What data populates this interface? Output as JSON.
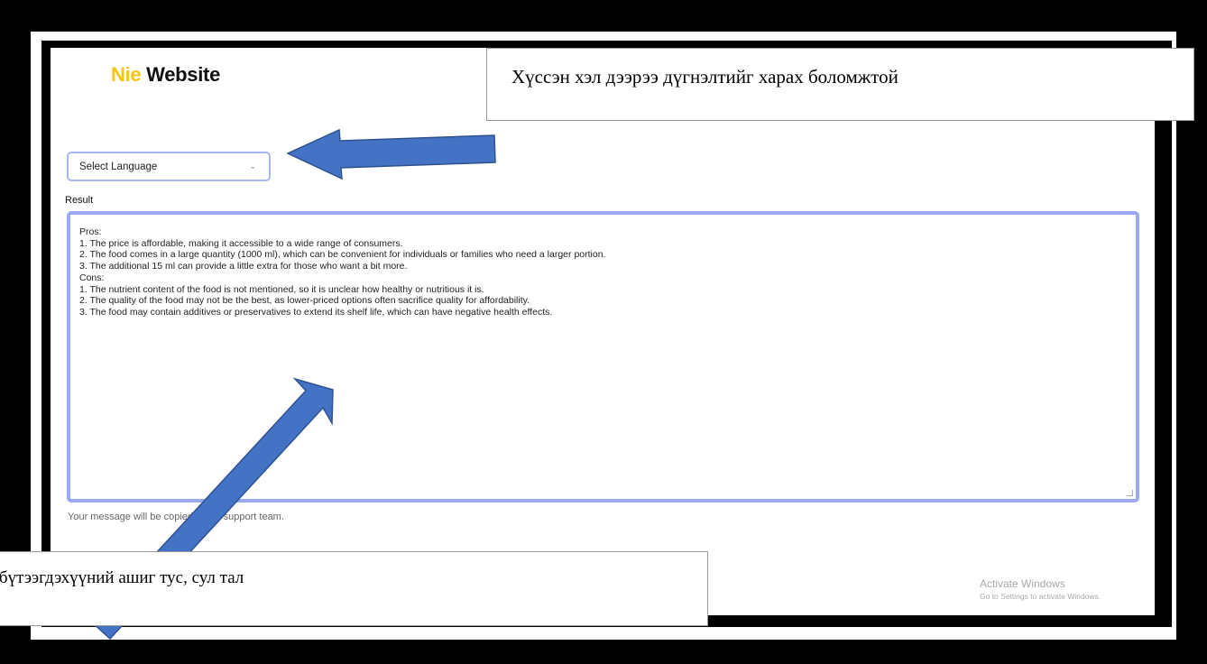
{
  "brand": {
    "prefix": "Nie",
    "name": " Website"
  },
  "language_select": {
    "placeholder": "Select Language",
    "chevron": "chevron-down-icon"
  },
  "result": {
    "label": "Result",
    "lines": [
      "Pros:",
      "1. The price is affordable, making it accessible to a wide range of consumers.",
      "2. The food comes in a large quantity (1000 ml), which can be convenient for individuals or families who need a larger portion.",
      "3. The additional 15 ml can provide a little extra for those who want a bit more.",
      "Cons:",
      "1. The nutrient content of the food is not mentioned, so it is unclear how healthy or nutritious it is.",
      "2. The quality of the food may not be the best, as lower-priced options often sacrifice quality for affordability.",
      "3. The food may contain additives or preservatives to extend its shelf life, which can have negative health effects."
    ]
  },
  "hint": "Your message will be copied to the support team.",
  "activate_windows": {
    "title": "Activate Windows",
    "subtitle": "Go to Settings to activate Windows."
  },
  "callouts": {
    "top": "Хүссэн хэл дээрээ дүгнэлтийг харах боломжтой",
    "bottom": "н бүтээгдэхүүний ашиг тус, сул тал"
  },
  "colors": {
    "brand_accent": "#f5c518",
    "border_accent": "#9aa9f0",
    "arrow": "#4472c4"
  }
}
